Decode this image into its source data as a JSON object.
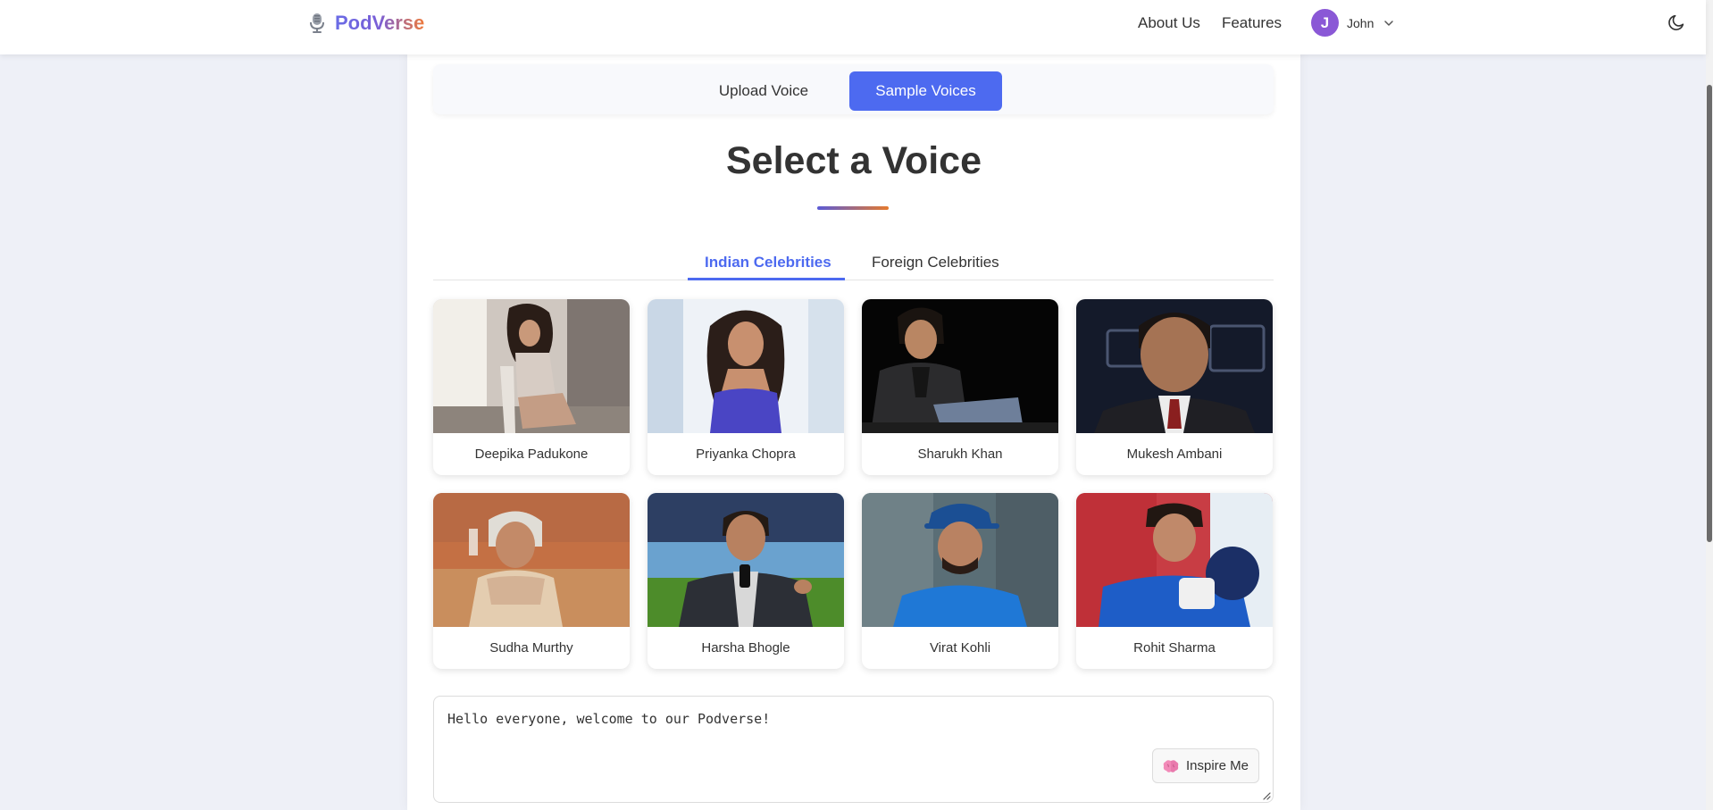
{
  "nav": {
    "brand": "PodVerse",
    "links": [
      "About Us",
      "Features"
    ],
    "user": {
      "initial": "J",
      "name": "John"
    }
  },
  "mode": {
    "upload": "Upload Voice",
    "sample": "Sample Voices",
    "active": "Sample Voices"
  },
  "main": {
    "title": "Select a Voice",
    "tabs": [
      "Indian Celebrities",
      "Foreign Celebrities"
    ],
    "active_tab": "Indian Celebrities"
  },
  "celebrities": [
    {
      "name": "Deepika Padukone"
    },
    {
      "name": "Priyanka Chopra"
    },
    {
      "name": "Sharukh Khan"
    },
    {
      "name": "Mukesh Ambani"
    },
    {
      "name": "Sudha Murthy"
    },
    {
      "name": "Harsha Bhogle"
    },
    {
      "name": "Virat Kohli"
    },
    {
      "name": "Rohit Sharma"
    }
  ],
  "input": {
    "value": "Hello everyone, welcome to our Podverse!",
    "inspire_label": "Inspire Me"
  },
  "colors": {
    "accent": "#4d6af0",
    "avatar": "#8a58d6",
    "brand_gradient_start": "#6a6ce6",
    "brand_gradient_end": "#ef7a3a"
  },
  "icons": {
    "brand": "microphone-icon",
    "user_menu": "chevron-down-icon",
    "theme": "moon-icon",
    "inspire": "brain-icon"
  }
}
